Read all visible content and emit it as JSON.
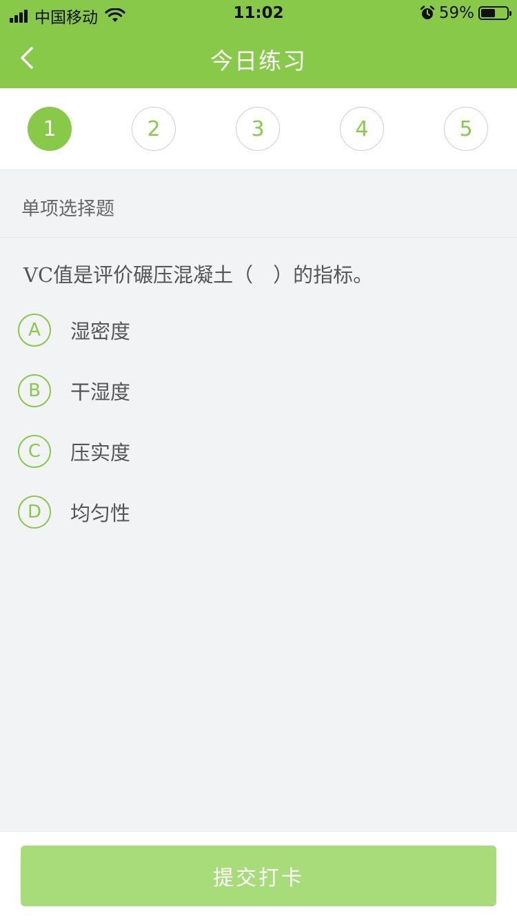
{
  "status_bar": {
    "carrier": "中国移动",
    "time": "11:02",
    "battery_percent": "59%",
    "battery_level": 0.59,
    "icons": [
      "signal-icon",
      "wifi-icon",
      "alarm-icon",
      "battery-icon"
    ]
  },
  "nav": {
    "title": "今日练习",
    "back_icon": "chevron-left-icon"
  },
  "steps": [
    {
      "label": "1",
      "active": true
    },
    {
      "label": "2",
      "active": false
    },
    {
      "label": "3",
      "active": false
    },
    {
      "label": "4",
      "active": false
    },
    {
      "label": "5",
      "active": false
    }
  ],
  "question": {
    "type_label": "单项选择题",
    "text": "VC值是评价碾压混凝土（　）的指标。",
    "options": [
      {
        "letter": "A",
        "text": "湿密度"
      },
      {
        "letter": "B",
        "text": "干湿度"
      },
      {
        "letter": "C",
        "text": "压实度"
      },
      {
        "letter": "D",
        "text": "均匀性"
      }
    ]
  },
  "footer": {
    "submit_label": "提交打卡"
  },
  "colors": {
    "brand": "#88c94a",
    "submit_disabled": "#a8dc7a",
    "background": "#f2f3f5"
  }
}
